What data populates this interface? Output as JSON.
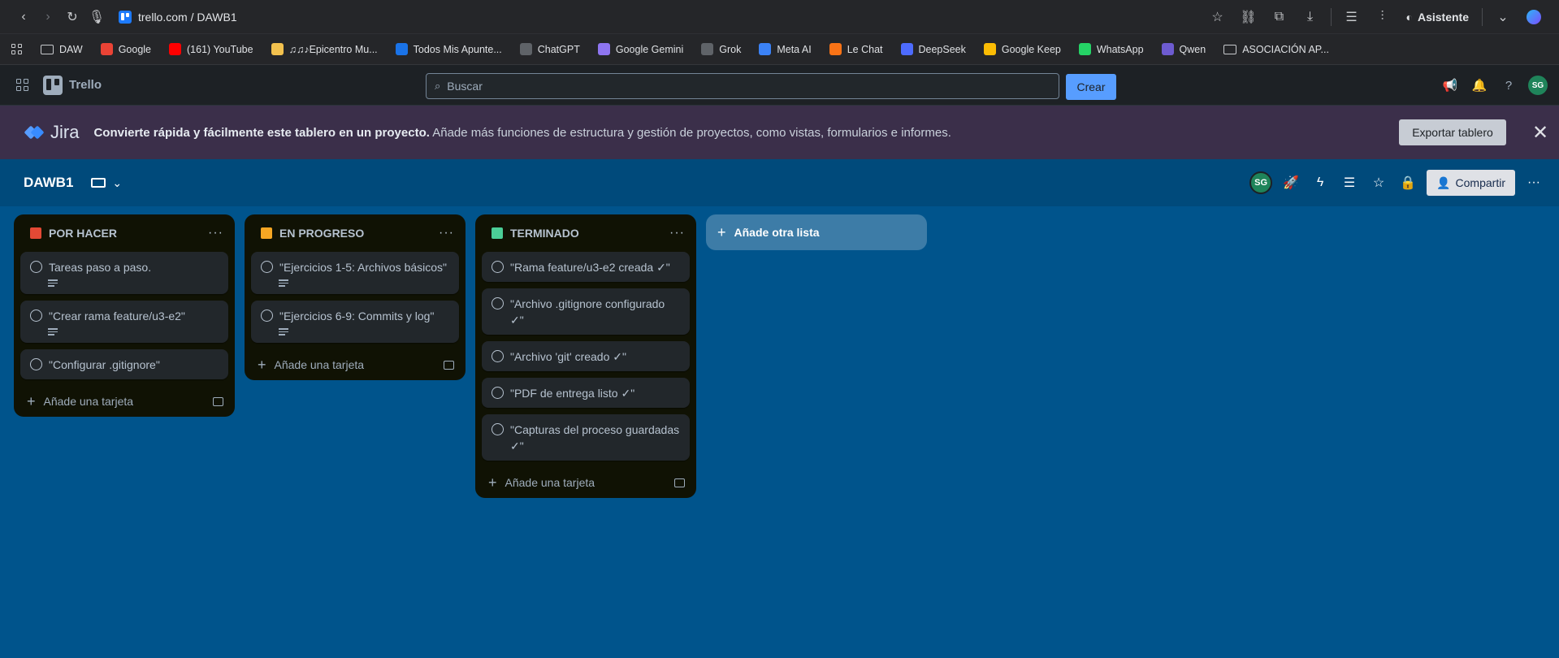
{
  "browser": {
    "url": "trello.com / DAWB1",
    "assistant_label": "Asistente"
  },
  "bookmarks": [
    {
      "label": "DAW",
      "icon": "folder-icon",
      "color": ""
    },
    {
      "label": "Google",
      "icon": "google-icon",
      "color": "#ea4335"
    },
    {
      "label": "(161) YouTube",
      "icon": "youtube-icon",
      "color": "#ff0000"
    },
    {
      "label": "♫♫♪Epicentro Mu...",
      "icon": "music-icon",
      "color": "#f2c14e"
    },
    {
      "label": "Todos Mis Apunte...",
      "icon": "notes-icon",
      "color": "#1a73e8"
    },
    {
      "label": "ChatGPT",
      "icon": "chatgpt-icon",
      "color": "#5f6368"
    },
    {
      "label": "Google Gemini",
      "icon": "gemini-icon",
      "color": "#8e75f0"
    },
    {
      "label": "Grok",
      "icon": "grok-icon",
      "color": "#5f6368"
    },
    {
      "label": "Meta AI",
      "icon": "meta-ai-icon",
      "color": "#3b82f6"
    },
    {
      "label": "Le Chat",
      "icon": "le-chat-icon",
      "color": "#f97316"
    },
    {
      "label": "DeepSeek",
      "icon": "deepseek-icon",
      "color": "#4d6bfe"
    },
    {
      "label": "Google Keep",
      "icon": "keep-icon",
      "color": "#fbbc04"
    },
    {
      "label": "WhatsApp",
      "icon": "whatsapp-icon",
      "color": "#25d366"
    },
    {
      "label": "Qwen",
      "icon": "qwen-icon",
      "color": "#6d5bd0"
    },
    {
      "label": "ASOCIACIÓN AP...",
      "icon": "folder-icon",
      "color": ""
    }
  ],
  "header": {
    "app_name": "Trello",
    "search_placeholder": "Buscar",
    "create_label": "Crear",
    "avatar_initials": "SG"
  },
  "banner": {
    "product": "Jira",
    "bold_text": "Convierte rápida y fácilmente este tablero en un proyecto.",
    "text": " Añade más funciones de estructura y gestión de proyectos, como vistas, formularios e informes.",
    "export_label": "Exportar tablero"
  },
  "board": {
    "title": "DAWB1",
    "avatar_initials": "SG",
    "share_label": "Compartir",
    "add_list_label": "Añade otra lista",
    "colors": {
      "background": "#00548c",
      "header": "#004a7b",
      "list": "#101204",
      "card": "#22272b"
    }
  },
  "lists": [
    {
      "title": "POR HACER",
      "emoji_color": "#e34935",
      "add_card_label": "Añade una tarjeta",
      "cards": [
        {
          "text": "Tareas paso a paso.",
          "has_description": true
        },
        {
          "text": "\"Crear rama feature/u3-e2\"",
          "has_description": true
        },
        {
          "text": "\"Configurar .gitignore\"",
          "has_description": false
        }
      ]
    },
    {
      "title": "EN PROGRESO",
      "emoji_color": "#f5a623",
      "add_card_label": "Añade una tarjeta",
      "cards": [
        {
          "text": "\"Ejercicios 1-5: Archivos básicos\"",
          "has_description": true
        },
        {
          "text": "\"Ejercicios 6-9: Commits y log\"",
          "has_description": true
        }
      ]
    },
    {
      "title": "TERMINADO",
      "emoji_color": "#4bce97",
      "add_card_label": "Añade una tarjeta",
      "cards": [
        {
          "text": "\"Rama feature/u3-e2 creada ✓\"",
          "has_description": false
        },
        {
          "text": "\"Archivo .gitignore configurado ✓\"",
          "has_description": false
        },
        {
          "text": "\"Archivo 'git' creado ✓\"",
          "has_description": false
        },
        {
          "text": "\"PDF de entrega listo ✓\"",
          "has_description": false
        },
        {
          "text": "\"Capturas del proceso guardadas ✓\"",
          "has_description": false
        }
      ]
    }
  ]
}
